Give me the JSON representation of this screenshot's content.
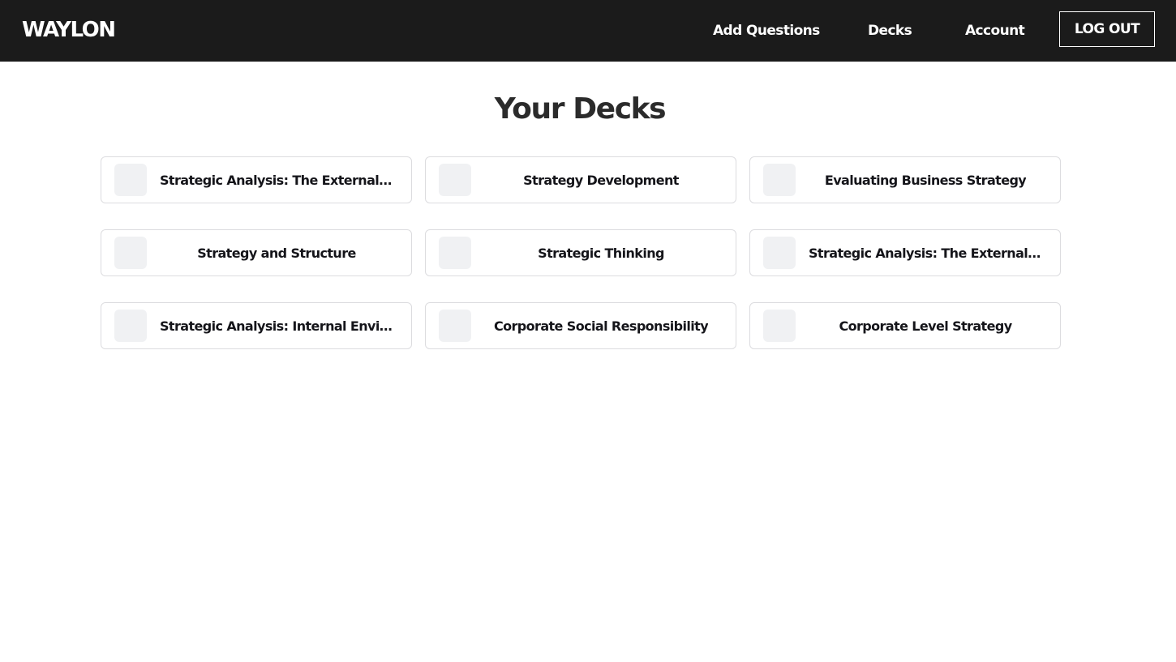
{
  "app": {
    "logo": "WAYLON"
  },
  "nav": {
    "add_questions": "Add Questions",
    "decks": "Decks",
    "account": "Account",
    "logout": "LOG OUT"
  },
  "page": {
    "title": "Your Decks"
  },
  "decks": [
    {
      "title": "Strategic Analysis: The External …"
    },
    {
      "title": "Strategy Development"
    },
    {
      "title": "Evaluating Business Strategy"
    },
    {
      "title": "Strategy and Structure"
    },
    {
      "title": "Strategic Thinking"
    },
    {
      "title": "Strategic Analysis: The External …"
    },
    {
      "title": "Strategic Analysis: Internal Envir…"
    },
    {
      "title": "Corporate Social Responsibility"
    },
    {
      "title": "Corporate Level Strategy"
    }
  ],
  "colors": {
    "navbar_bg": "#1b1b1b",
    "nav_text": "#ffffff",
    "title_text": "#2b2b2b",
    "card_border": "#dcdcdf",
    "thumb_bg": "#f0f1f3"
  }
}
